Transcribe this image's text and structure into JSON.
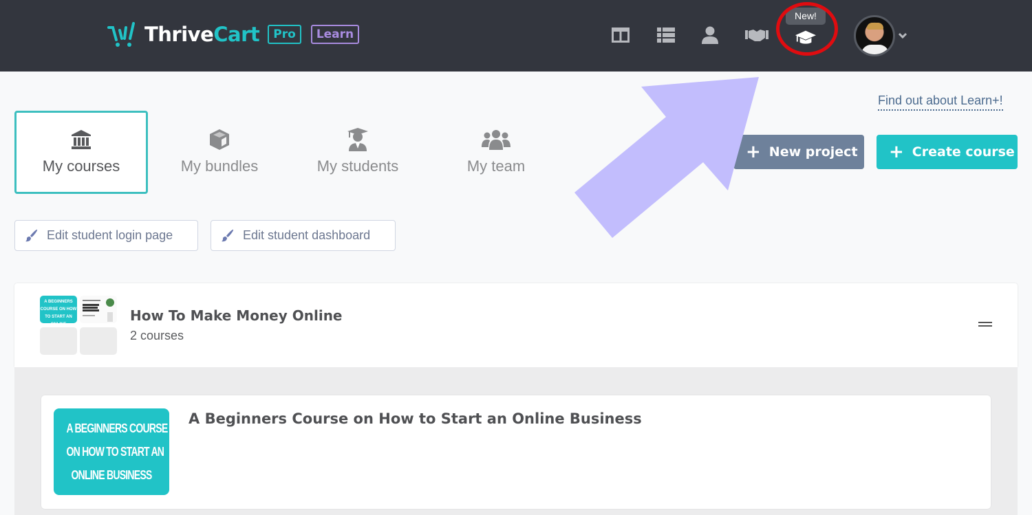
{
  "header": {
    "logo": {
      "text_white": "Thrive",
      "text_accent": "Cart",
      "badge_pro": "Pro",
      "badge_learn": "Learn"
    },
    "nav_icons": [
      {
        "name": "dashboard-icon"
      },
      {
        "name": "products-list-icon"
      },
      {
        "name": "customers-icon"
      },
      {
        "name": "affiliates-handshake-icon"
      },
      {
        "name": "learn-graduation-cap-icon"
      }
    ],
    "new_tooltip": "New!",
    "avatar_alt": "User avatar"
  },
  "tabs": [
    {
      "label": "My courses",
      "icon": "bank-icon",
      "active": true
    },
    {
      "label": "My bundles",
      "icon": "cube-icon",
      "active": false
    },
    {
      "label": "My students",
      "icon": "student-icon",
      "active": false
    },
    {
      "label": "My team",
      "icon": "team-icon",
      "active": false
    }
  ],
  "learn_plus_link": "Find out about Learn+!",
  "actions": {
    "new_project": "New project",
    "create_course": "Create course",
    "plus": "+"
  },
  "edit_buttons": {
    "login": "Edit student login page",
    "dashboard": "Edit student dashboard"
  },
  "project": {
    "title": "How To Make Money Online",
    "count": "2 courses",
    "thumb_text": "A BEGINNERS COURSE ON HOW TO START AN ONLINE BUSINESS",
    "courses": [
      {
        "title": "A Beginners Course on How to Start an Online Business",
        "thumb_lines": [
          "A BEGINNERS COURSE",
          "ON HOW TO START AN",
          "ONLINE BUSINESS"
        ]
      }
    ]
  },
  "colors": {
    "brand_teal": "#21c3c7",
    "learn_purple": "#a98ce0",
    "header_bg": "#33363e",
    "new_project_bg": "#6e819b",
    "annotation_arrow": "#c2bdfd",
    "annotation_circle": "#e00c10"
  }
}
